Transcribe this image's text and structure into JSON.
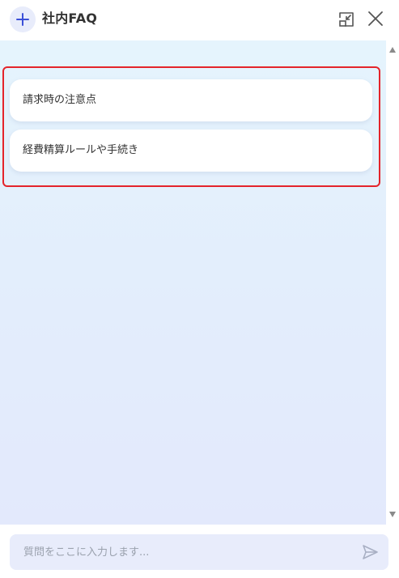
{
  "header": {
    "title": "社内FAQ",
    "new_chat_icon": "plus-icon",
    "minimize_icon": "minimize-window-icon",
    "close_icon": "close-icon"
  },
  "suggestions": [
    {
      "label": "請求時の注意点"
    },
    {
      "label": "経費精算ルールや手続き"
    }
  ],
  "input": {
    "placeholder": "質問をここに入力します...",
    "value": "",
    "send_icon": "send-icon"
  },
  "colors": {
    "accent": "#3b4fd8",
    "highlight_border": "#e4242b",
    "icon_gray": "#555555",
    "send_icon": "#a9b0c4"
  }
}
